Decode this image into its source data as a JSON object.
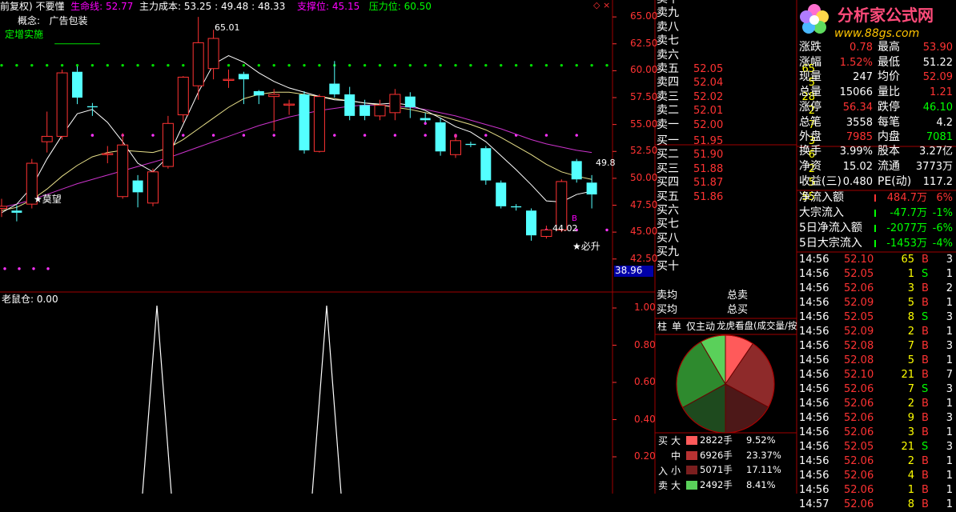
{
  "header": {
    "fq": "前复权)",
    "name": "不要懂",
    "lifeline_label": "生命线:",
    "lifeline_val": "52.77",
    "cost_label": "主力成本:",
    "cost_val": "53.25 : 49.48 : 48.33",
    "support_label": "支撑位:",
    "support_val": "45.15",
    "pressure_label": "压力位:",
    "pressure_val": "60.50",
    "concept_label": "概念:",
    "concept_val": "广告包装",
    "event": "定增实施"
  },
  "annotations": {
    "hi": "65.01",
    "lo": "44.02",
    "right": "49.8",
    "buy1": "★莫望",
    "buy2": "★必升",
    "rlabel": "38.96"
  },
  "price_axis": [
    "65.00",
    "62.50",
    "60.00",
    "57.50",
    "55.00",
    "52.50",
    "50.00",
    "47.50",
    "45.00",
    "42.50"
  ],
  "indicator": {
    "title": "老鼠仓: 0.00",
    "axis": [
      "1.00",
      "0.80",
      "0.60",
      "0.40",
      "0.20"
    ]
  },
  "chart_data": {
    "type": "candlestick",
    "ylim": [
      40.4,
      66.2
    ],
    "candles": [
      {
        "o": 47.2,
        "c": 47.4,
        "h": 48.1,
        "l": 46.4
      },
      {
        "o": 47.0,
        "c": 46.8,
        "h": 47.5,
        "l": 46.0
      },
      {
        "o": 47.6,
        "c": 51.4,
        "h": 51.8,
        "l": 47.2
      },
      {
        "o": 53.4,
        "c": 53.9,
        "h": 56.2,
        "l": 52.4
      },
      {
        "o": 53.9,
        "c": 59.8,
        "h": 60.1,
        "l": 53.6
      },
      {
        "o": 59.9,
        "c": 57.5,
        "h": 60.4,
        "l": 56.9
      },
      {
        "o": 56.7,
        "c": 56.6,
        "h": 57.0,
        "l": 55.8
      },
      {
        "o": 52.2,
        "c": 52.3,
        "h": 53.0,
        "l": 51.4
      },
      {
        "o": 48.3,
        "c": 53.1,
        "h": 54.2,
        "l": 48.1
      },
      {
        "o": 49.8,
        "c": 48.7,
        "h": 50.3,
        "l": 47.3
      },
      {
        "o": 47.7,
        "c": 50.6,
        "h": 50.9,
        "l": 47.4
      },
      {
        "o": 51.1,
        "c": 55.1,
        "h": 55.8,
        "l": 50.9
      },
      {
        "o": 55.9,
        "c": 59.4,
        "h": 59.5,
        "l": 55.2
      },
      {
        "o": 58.6,
        "c": 62.6,
        "h": 65.0,
        "l": 57.3
      },
      {
        "o": 60.2,
        "c": 63.0,
        "h": 63.8,
        "l": 59.2
      },
      {
        "o": 59.1,
        "c": 59.2,
        "h": 60.1,
        "l": 58.4
      },
      {
        "o": 59.7,
        "c": 59.2,
        "h": 59.9,
        "l": 56.9
      },
      {
        "o": 58.1,
        "c": 57.7,
        "h": 58.2,
        "l": 56.9
      },
      {
        "o": 57.6,
        "c": 57.8,
        "h": 58.3,
        "l": 54.4
      },
      {
        "o": 56.8,
        "c": 56.9,
        "h": 57.3,
        "l": 55.9
      },
      {
        "o": 57.8,
        "c": 52.6,
        "h": 58.1,
        "l": 52.3
      },
      {
        "o": 52.5,
        "c": 57.6,
        "h": 57.8,
        "l": 52.4
      },
      {
        "o": 58.8,
        "c": 57.8,
        "h": 60.9,
        "l": 57.5
      },
      {
        "o": 57.8,
        "c": 55.8,
        "h": 58.5,
        "l": 55.4
      },
      {
        "o": 56.8,
        "c": 55.8,
        "h": 57.3,
        "l": 55.4
      },
      {
        "o": 55.8,
        "c": 56.8,
        "h": 57.3,
        "l": 55.4
      },
      {
        "o": 56.1,
        "c": 57.8,
        "h": 58.3,
        "l": 55.4
      },
      {
        "o": 57.6,
        "c": 56.6,
        "h": 58.0,
        "l": 55.6
      },
      {
        "o": 55.6,
        "c": 55.4,
        "h": 56.1,
        "l": 55.2
      },
      {
        "o": 55.2,
        "c": 52.5,
        "h": 55.6,
        "l": 52.1
      },
      {
        "o": 52.2,
        "c": 53.5,
        "h": 54.1,
        "l": 51.9
      },
      {
        "o": 53.2,
        "c": 53.1,
        "h": 53.4,
        "l": 52.9
      },
      {
        "o": 52.8,
        "c": 49.8,
        "h": 53.0,
        "l": 49.4
      },
      {
        "o": 49.6,
        "c": 47.4,
        "h": 49.8,
        "l": 47.2
      },
      {
        "o": 47.4,
        "c": 47.3,
        "h": 47.6,
        "l": 47.0
      },
      {
        "o": 47.0,
        "c": 44.7,
        "h": 47.2,
        "l": 44.2
      },
      {
        "o": 44.6,
        "c": 45.2,
        "h": 45.6,
        "l": 44.4
      },
      {
        "o": 45.2,
        "c": 49.7,
        "h": 49.9,
        "l": 45.0
      },
      {
        "o": 51.6,
        "c": 49.9,
        "h": 51.8,
        "l": 49.6
      },
      {
        "o": 49.6,
        "c": 48.5,
        "h": 50.3,
        "l": 47.2
      }
    ],
    "ma_white": [
      46.8,
      47.6,
      49.2,
      51.8,
      54.0,
      56.0,
      56.4,
      55.2,
      53.4,
      51.4,
      50.6,
      52.0,
      55.0,
      58.0,
      60.6,
      61.4,
      60.8,
      59.8,
      59.0,
      58.4,
      58.0,
      57.6,
      57.3,
      57.2,
      57.0,
      56.9,
      57.0,
      56.8,
      56.3,
      55.6,
      54.8,
      54.3,
      53.4,
      52.1,
      50.8,
      49.4,
      47.9,
      47.8,
      48.5,
      48.8
    ],
    "ma_yellow": [
      47.0,
      47.3,
      48.0,
      49.0,
      50.2,
      51.2,
      52.0,
      52.4,
      52.6,
      52.5,
      52.4,
      52.8,
      53.6,
      54.6,
      55.6,
      56.6,
      57.4,
      57.8,
      58.0,
      58.0,
      57.8,
      57.6,
      57.4,
      57.2,
      57.0,
      56.8,
      56.6,
      56.4,
      56.1,
      55.8,
      55.4,
      55.0,
      54.5,
      53.8,
      53.0,
      52.2,
      51.3,
      50.6,
      50.2,
      49.9
    ],
    "ma_magenta": [
      47.3,
      47.6,
      48.0,
      48.5,
      49.0,
      49.5,
      49.9,
      50.3,
      50.7,
      51.1,
      51.5,
      51.9,
      52.4,
      52.9,
      53.4,
      53.9,
      54.4,
      54.9,
      55.3,
      55.7,
      56.0,
      56.3,
      56.5,
      56.7,
      56.8,
      56.8,
      56.7,
      56.6,
      56.4,
      56.1,
      55.8,
      55.4,
      55.0,
      54.6,
      54.1,
      53.6,
      53.2,
      52.9,
      52.6,
      52.4
    ],
    "pressure_level": 60.5,
    "support_level": 45.15,
    "indicator_spikes_x": [
      196,
      408
    ],
    "indicator_range": [
      0,
      1
    ]
  },
  "orderbook": {
    "sell": [
      {
        "l": "卖十",
        "p": "",
        "v": ""
      },
      {
        "l": "卖九",
        "p": "",
        "v": ""
      },
      {
        "l": "卖八",
        "p": "",
        "v": ""
      },
      {
        "l": "卖七",
        "p": "",
        "v": ""
      },
      {
        "l": "卖六",
        "p": "",
        "v": ""
      },
      {
        "l": "卖五",
        "p": "52.05",
        "v": "65"
      },
      {
        "l": "卖四",
        "p": "52.04",
        "v": "5"
      },
      {
        "l": "卖三",
        "p": "52.02",
        "v": "28"
      },
      {
        "l": "卖二",
        "p": "52.01",
        "v": "2"
      },
      {
        "l": "卖一",
        "p": "52.00",
        "v": "7"
      }
    ],
    "buy": [
      {
        "l": "买一",
        "p": "51.95",
        "v": "3"
      },
      {
        "l": "买二",
        "p": "51.90",
        "v": "6"
      },
      {
        "l": "买三",
        "p": "51.88",
        "v": "2"
      },
      {
        "l": "买四",
        "p": "51.87",
        "v": "5"
      },
      {
        "l": "买五",
        "p": "51.86",
        "v": "55"
      },
      {
        "l": "买六",
        "p": "",
        "v": ""
      },
      {
        "l": "买七",
        "p": "",
        "v": ""
      },
      {
        "l": "买八",
        "p": "",
        "v": ""
      },
      {
        "l": "买九",
        "p": "",
        "v": ""
      },
      {
        "l": "买十",
        "p": "",
        "v": ""
      }
    ],
    "avg_sell": "卖均",
    "avg_buy": "买均",
    "total_sell": "总卖",
    "total_buy": "总买"
  },
  "tabs": [
    "柱",
    "单",
    "仅主动",
    "龙虎看盘(成交量/按"
  ],
  "pie": {
    "side_buy": "买",
    "side_in": "入",
    "side_sell": "卖",
    "rows": [
      {
        "size": "大",
        "color": "#ff5a5a",
        "amt": "2822手",
        "pct": "9.52%"
      },
      {
        "size": "中",
        "color": "#b83232",
        "amt": "6926手",
        "pct": "23.37%"
      },
      {
        "size": "小",
        "color": "#7a1e1e",
        "amt": "5071手",
        "pct": "17.11%"
      },
      {
        "size": "大",
        "color": "#5ad05a",
        "amt": "2492手",
        "pct": "8.41%"
      }
    ],
    "slices": [
      {
        "color": "#ff5a5a",
        "v": 9.52
      },
      {
        "color": "#8e2a2a",
        "v": 23.37
      },
      {
        "color": "#4d1818",
        "v": 17.11
      },
      {
        "color": "#1e4a1e",
        "v": 17.0
      },
      {
        "color": "#2e8a2e",
        "v": 24.6
      },
      {
        "color": "#5ad05a",
        "v": 8.41
      }
    ]
  },
  "logo": {
    "brand": "分析家公式网",
    "url": "www.88gs.com"
  },
  "quote": {
    "rows": [
      {
        "a": "涨跌",
        "b": "0.78",
        "c": "最高",
        "d": "53.90",
        "bc": "red",
        "dc": "red"
      },
      {
        "a": "涨幅",
        "b": "1.52%",
        "c": "最低",
        "d": "51.22",
        "bc": "red",
        "dc": "wht"
      },
      {
        "a": "现量",
        "b": "247",
        "c": "均价",
        "d": "52.09",
        "bc": "wht",
        "dc": "red"
      },
      {
        "a": "总量",
        "b": "15066",
        "c": "量比",
        "d": "1.21",
        "bc": "wht",
        "dc": "red"
      },
      {
        "a": "涨停",
        "b": "56.34",
        "c": "跌停",
        "d": "46.10",
        "bc": "red",
        "dc": "grn"
      },
      {
        "a": "总笔",
        "b": "3558",
        "c": "每笔",
        "d": "4.2",
        "bc": "wht",
        "dc": "wht"
      },
      {
        "a": "外盘",
        "b": "7985",
        "c": "内盘",
        "d": "7081",
        "bc": "red",
        "dc": "grn"
      }
    ],
    "rows2": [
      {
        "a": "换手",
        "b": "3.99%",
        "c": "股本",
        "d": "3.27亿"
      },
      {
        "a": "净资",
        "b": "15.02",
        "c": "流通",
        "d": "3773万"
      },
      {
        "a": "收益(三)",
        "b": "0.480",
        "c": "PE(动)",
        "d": "117.2"
      }
    ],
    "flows": [
      {
        "a": "净流入额",
        "b": "484.7万",
        "c": "6%",
        "col": "red",
        "bar": "#ff3333"
      },
      {
        "a": "大宗流入",
        "b": "-47.7万",
        "c": "-1%",
        "col": "grn",
        "bar": "#00ff00"
      },
      {
        "a": "5日净流入额",
        "b": "-2077万",
        "c": "-6%",
        "col": "grn",
        "bar": "#00ff00"
      },
      {
        "a": "5日大宗流入",
        "b": "-1453万",
        "c": "-4%",
        "col": "grn",
        "bar": "#00ff00"
      }
    ]
  },
  "ticks": [
    {
      "t": "14:56",
      "p": "52.10",
      "v": "65",
      "s": "B",
      "n": "3"
    },
    {
      "t": "14:56",
      "p": "52.05",
      "v": "1",
      "s": "S",
      "n": "1"
    },
    {
      "t": "14:56",
      "p": "52.06",
      "v": "3",
      "s": "B",
      "n": "2"
    },
    {
      "t": "14:56",
      "p": "52.09",
      "v": "5",
      "s": "B",
      "n": "1"
    },
    {
      "t": "14:56",
      "p": "52.05",
      "v": "8",
      "s": "S",
      "n": "3"
    },
    {
      "t": "14:56",
      "p": "52.09",
      "v": "2",
      "s": "B",
      "n": "1"
    },
    {
      "t": "14:56",
      "p": "52.08",
      "v": "7",
      "s": "B",
      "n": "3"
    },
    {
      "t": "14:56",
      "p": "52.08",
      "v": "5",
      "s": "B",
      "n": "1"
    },
    {
      "t": "14:56",
      "p": "52.10",
      "v": "21",
      "s": "B",
      "n": "7"
    },
    {
      "t": "14:56",
      "p": "52.06",
      "v": "7",
      "s": "S",
      "n": "3"
    },
    {
      "t": "14:56",
      "p": "52.06",
      "v": "2",
      "s": "B",
      "n": "1"
    },
    {
      "t": "14:56",
      "p": "52.06",
      "v": "9",
      "s": "B",
      "n": "3"
    },
    {
      "t": "14:56",
      "p": "52.06",
      "v": "3",
      "s": "B",
      "n": "1"
    },
    {
      "t": "14:56",
      "p": "52.05",
      "v": "21",
      "s": "S",
      "n": "3"
    },
    {
      "t": "14:56",
      "p": "52.06",
      "v": "2",
      "s": "B",
      "n": "1"
    },
    {
      "t": "14:56",
      "p": "52.06",
      "v": "4",
      "s": "B",
      "n": "1"
    },
    {
      "t": "14:56",
      "p": "52.06",
      "v": "1",
      "s": "B",
      "n": "1"
    },
    {
      "t": "14:57",
      "p": "52.06",
      "v": "8",
      "s": "B",
      "n": "1"
    }
  ]
}
